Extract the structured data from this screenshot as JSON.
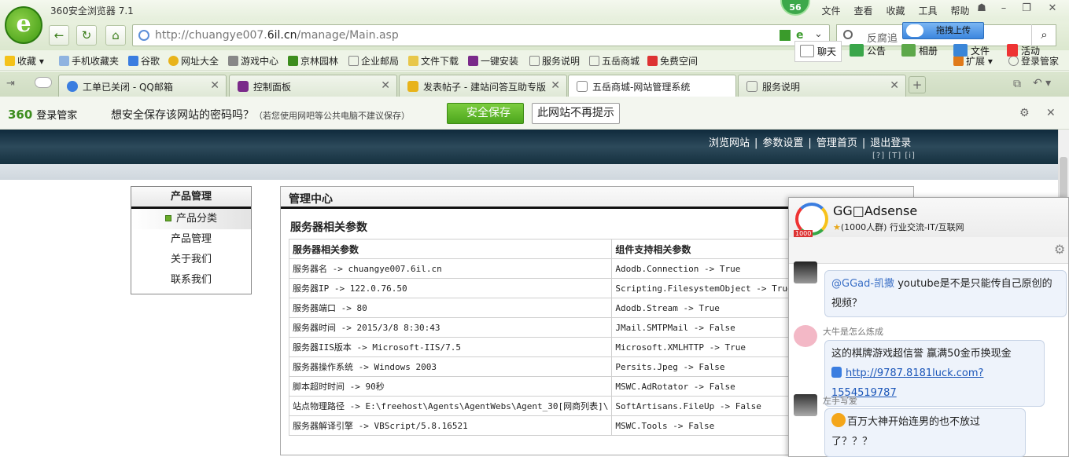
{
  "browser": {
    "title": "360安全浏览器 7.1",
    "badge_count": "56",
    "menus": [
      "文件",
      "查看",
      "收藏",
      "工具",
      "帮助"
    ],
    "url_prefix": "http://chuangye007.",
    "url_domain": "6il.cn",
    "url_path": "/manage/Main.asp",
    "search_placeholder": "反腐追",
    "upload_label": "拖拽上传"
  },
  "favorites": {
    "items": [
      "收藏",
      "手机收藏夹",
      "谷歌",
      "网址大全",
      "游戏中心",
      "京林园林",
      "企业邮局",
      "文件下载",
      "一键安装",
      "服务说明",
      "五岳商城",
      "免费空间"
    ],
    "extend": "扩展",
    "login": "登录管家"
  },
  "tabs": [
    {
      "label": "工单已关闭 - QQ邮箱"
    },
    {
      "label": "控制面板"
    },
    {
      "label": "发表帖子 - 建站问答互助专版"
    },
    {
      "label": "五岳商城-网站管理系统"
    },
    {
      "label": "服务说明"
    }
  ],
  "password_bar": {
    "logo": "360",
    "logo_text": "登录管家",
    "question": "想安全保存该网站的密码吗？",
    "hint": "（若您使用网吧等公共电脑不建议保存）",
    "save_button": "安全保存",
    "never_button": "此网站不再提示"
  },
  "site": {
    "nav": [
      "浏览网站",
      "参数设置",
      "管理首页",
      "退出登录"
    ],
    "mini_links": "[?] [T] [i]"
  },
  "sidebar": {
    "title": "产品管理",
    "items": [
      "产品分类",
      "产品管理",
      "关于我们",
      "联系我们"
    ]
  },
  "main": {
    "title": "管理中心",
    "section_title": "服务器相关参数",
    "col1_header": "服务器相关参数",
    "col2_header": "组件支持相关参数",
    "rows": [
      [
        "服务器名 -> chuangye007.6il.cn",
        "Adodb.Connection -> True"
      ],
      [
        "服务器IP -> 122.0.76.50",
        "Scripting.FilesystemObject -> True"
      ],
      [
        "服务器端口 -> 80",
        "Adodb.Stream -> True"
      ],
      [
        "服务器时间 -> 2015/3/8 8:30:43",
        "JMail.SMTPMail -> False"
      ],
      [
        "服务器IIS版本 -> Microsoft-IIS/7.5",
        "Microsoft.XMLHTTP -> True"
      ],
      [
        "服务器操作系统 -> Windows 2003",
        "Persits.Jpeg -> False"
      ],
      [
        "脚本超时时间 -> 90秒",
        "MSWC.AdRotator -> False"
      ],
      [
        "站点物理路径 -> E:\\freehost\\Agents\\AgentWebs\\Agent_30[网商列表]\\",
        "SoftArtisans.FileUp -> False"
      ],
      [
        "服务器解译引擎 -> VBScript/5.8.16521",
        "MSWC.Tools -> False"
      ]
    ]
  },
  "chat": {
    "group_name": "GG□Adsense",
    "group_badge": "1000",
    "group_info": "(1000人群) 行业交流-IT/互联网",
    "tabs": [
      "聊天",
      "公告",
      "相册",
      "文件",
      "活动"
    ],
    "messages": [
      {
        "mention": "@GGad-凯撒",
        "text": " youtube是不是只能传自己原创的视频？"
      },
      {
        "name": "大牛是怎么炼成",
        "text": "这的棋牌游戏超信誉 赢满50金币换现金",
        "link": "http://9787.8181luck.com?1554519787"
      },
      {
        "name": "左手写爱",
        "text": "百万大神开始连男的也不放过了？？？"
      }
    ]
  },
  "colors": {
    "accent_green": "#4ba61c",
    "site_header": "#1d3a4c",
    "link_blue": "#1a55b8"
  }
}
